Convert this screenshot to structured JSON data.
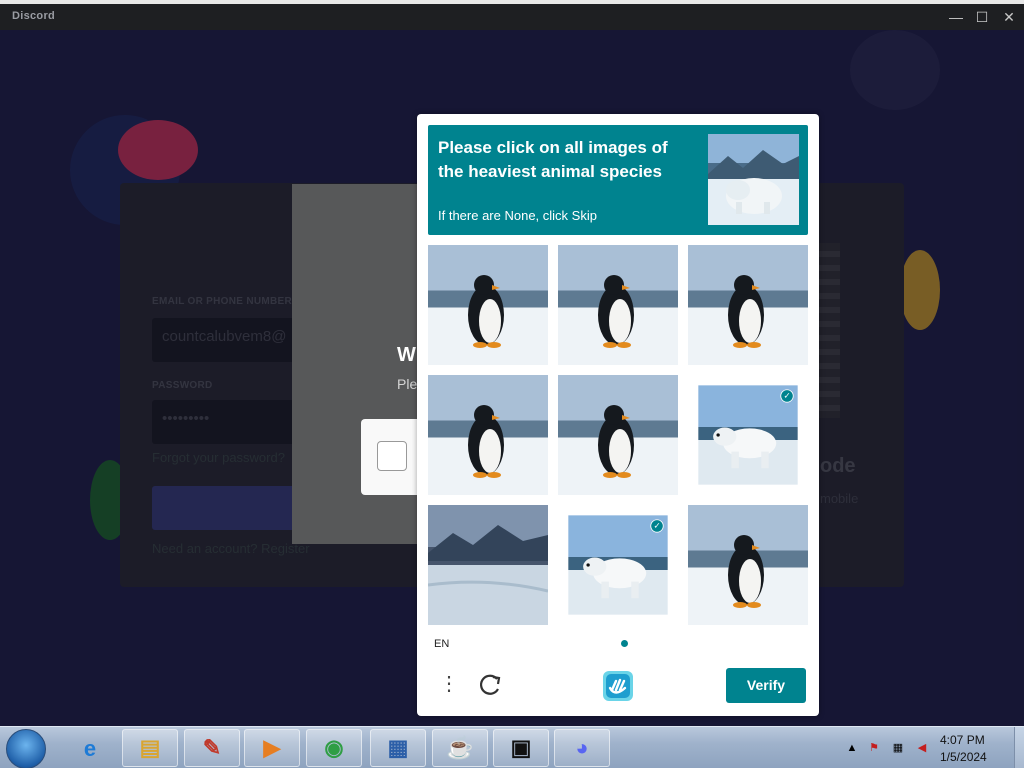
{
  "window": {
    "title": "Discord",
    "minimize": "—",
    "maximize": "☐",
    "close": "✕"
  },
  "login": {
    "email_label": "EMAIL OR PHONE NUMBER",
    "email_value": "countcalubvem8@",
    "password_label": "PASSWORD",
    "password_value": "•••••••••",
    "forgot": "Forgot your password?",
    "register": "Need an account? Register",
    "qr_title": "ode",
    "qr_sub": "mobile"
  },
  "host_modal": {
    "title": "W",
    "subtitle": "Ple"
  },
  "captcha": {
    "prompt": "Please click on all images of the heaviest animal species",
    "hint": "If there are None, click Skip",
    "language": "EN",
    "verify_label": "Verify",
    "check_glyph": "✓",
    "tiles": [
      {
        "subject": "penguin",
        "selected": false
      },
      {
        "subject": "penguin",
        "selected": false
      },
      {
        "subject": "penguin",
        "selected": false
      },
      {
        "subject": "penguin",
        "selected": false
      },
      {
        "subject": "penguin",
        "selected": false
      },
      {
        "subject": "polar-bear",
        "selected": true
      },
      {
        "subject": "landscape",
        "selected": false
      },
      {
        "subject": "polar-bear",
        "selected": true
      },
      {
        "subject": "penguin",
        "selected": false
      }
    ],
    "accent_color": "#00838f"
  },
  "taskbar": {
    "apps": [
      "internet-explorer-icon",
      "file-explorer-icon",
      "paint-icon",
      "media-player-icon",
      "chrome-icon",
      "control-panel-icon",
      "java-icon",
      "onion-terminal-icon",
      "discord-icon"
    ],
    "time": "4:07 PM",
    "date": "1/5/2024"
  }
}
